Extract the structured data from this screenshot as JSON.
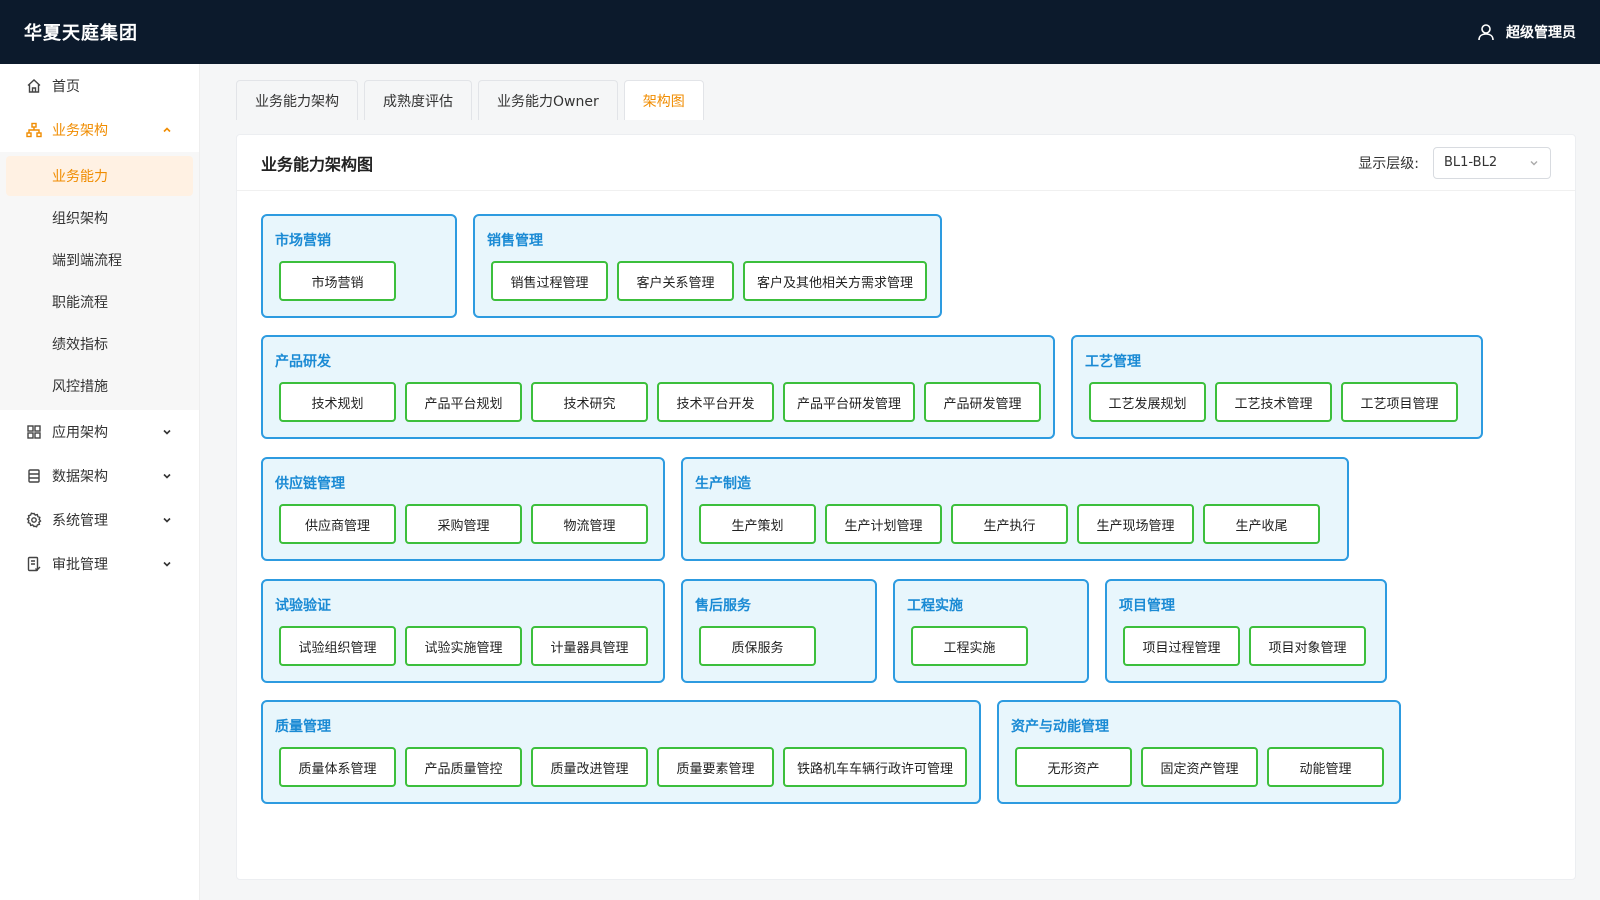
{
  "app": {
    "title": "华夏天庭集团"
  },
  "user": {
    "name": "超级管理员",
    "icon": "user-icon"
  },
  "sidebar": {
    "items": [
      {
        "label": "首页",
        "icon": "home-icon"
      },
      {
        "label": "业务架构",
        "icon": "org-icon",
        "expanded": true,
        "children": [
          "业务能力",
          "组织架构",
          "端到端流程",
          "职能流程",
          "绩效指标",
          "风控措施"
        ],
        "active_child": "业务能力"
      },
      {
        "label": "应用架构",
        "icon": "grid-icon"
      },
      {
        "label": "数据架构",
        "icon": "database-icon"
      },
      {
        "label": "系统管理",
        "icon": "gear-icon"
      },
      {
        "label": "审批管理",
        "icon": "approval-icon"
      }
    ]
  },
  "tabs": [
    "业务能力架构",
    "成熟度评估",
    "业务能力Owner",
    "架构图"
  ],
  "active_tab": "架构图",
  "panel": {
    "title": "业务能力架构图",
    "level_label": "显示层级:",
    "level_value": "BL1-BL2"
  },
  "domains": [
    {
      "title": "市场营销",
      "caps": [
        "市场营销"
      ]
    },
    {
      "title": "销售管理",
      "caps": [
        "销售过程管理",
        "客户关系管理",
        "客户及其他相关方需求管理"
      ]
    },
    {
      "title": "产品研发",
      "caps": [
        "技术规划",
        "产品平台规划",
        "技术研究",
        "技术平台开发",
        "产品平台研发管理",
        "产品研发管理"
      ]
    },
    {
      "title": "工艺管理",
      "caps": [
        "工艺发展规划",
        "工艺技术管理",
        "工艺项目管理"
      ]
    },
    {
      "title": "供应链管理",
      "caps": [
        "供应商管理",
        "采购管理",
        "物流管理"
      ]
    },
    {
      "title": "生产制造",
      "caps": [
        "生产策划",
        "生产计划管理",
        "生产执行",
        "生产现场管理",
        "生产收尾"
      ]
    },
    {
      "title": "试验验证",
      "caps": [
        "试验组织管理",
        "试验实施管理",
        "计量器具管理"
      ]
    },
    {
      "title": "售后服务",
      "caps": [
        "质保服务"
      ]
    },
    {
      "title": "工程实施",
      "caps": [
        "工程实施"
      ]
    },
    {
      "title": "项目管理",
      "caps": [
        "项目过程管理",
        "项目对象管理"
      ]
    },
    {
      "title": "质量管理",
      "caps": [
        "质量体系管理",
        "产品质量管控",
        "质量改进管理",
        "质量要素管理",
        "铁路机车车辆行政许可管理"
      ]
    },
    {
      "title": "资产与动能管理",
      "caps": [
        "无形资产",
        "固定资产管理",
        "动能管理"
      ]
    }
  ],
  "colors": {
    "header_bg": "#0c1a2c",
    "accent": "#f08c00",
    "domain_border": "#2d9be0",
    "domain_bg": "#e8f6fc",
    "domain_title": "#1a8ad4",
    "capability_border": "#3cbf3c"
  }
}
